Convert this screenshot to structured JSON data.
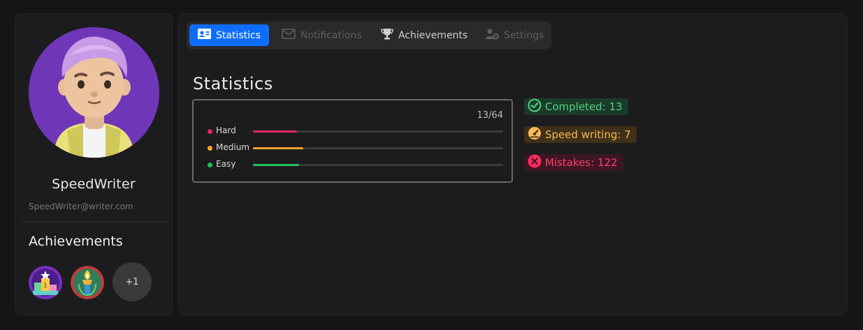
{
  "profile": {
    "username": "SpeedWriter",
    "email": "SpeedWriter@writer.com",
    "achievements_title": "Achievements",
    "badges": [
      "podium-badge",
      "torch-badge"
    ],
    "more_badges": "+1"
  },
  "tabs": [
    {
      "label": "Statistics",
      "icon": "id-card-icon",
      "state": "active"
    },
    {
      "label": "Notifications",
      "icon": "envelope-icon",
      "state": "disabled"
    },
    {
      "label": "Achievements",
      "icon": "trophy-icon",
      "state": "enabled"
    },
    {
      "label": "Settings",
      "icon": "user-gear-icon",
      "state": "disabled"
    }
  ],
  "stats": {
    "title": "Statistics",
    "count": "13/64",
    "rows": [
      {
        "label": "Hard",
        "color": "#e6245c",
        "fraction": 0.175
      },
      {
        "label": "Medium",
        "color": "#f5a52c",
        "fraction": 0.2
      },
      {
        "label": "Easy",
        "color": "#21c25a",
        "fraction": 0.185
      }
    ]
  },
  "summary": {
    "completed": "Completed: 13",
    "speed": "Speed writing: 7",
    "mistakes": "Mistakes: 122"
  },
  "colors": {
    "accent": "#0d6efd",
    "completed_bg": "#1a3b2a",
    "completed_fg": "#4fd17f",
    "speed_bg": "#3f3019",
    "speed_fg": "#f7b955",
    "mistakes_bg": "#3d1624",
    "mistakes_fg": "#ff3e6c"
  }
}
